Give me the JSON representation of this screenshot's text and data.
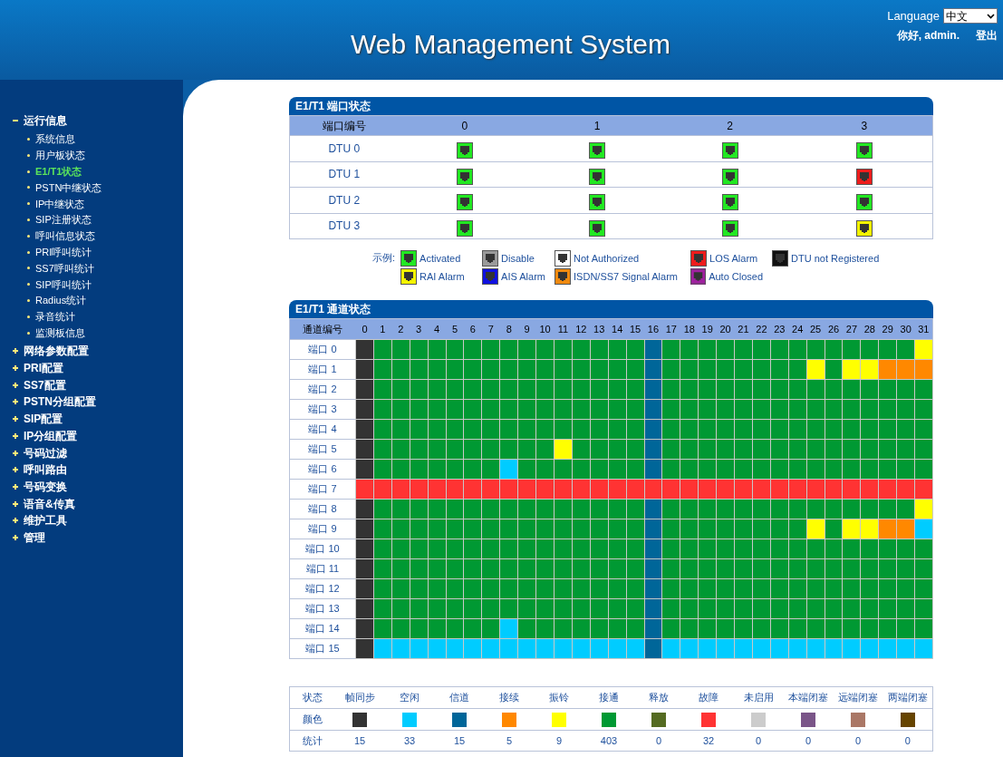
{
  "header": {
    "title": "Web Management System",
    "language_label": "Language",
    "language": "中文",
    "greeting": "你好, admin.",
    "logout": "登出"
  },
  "sidebar": {
    "items": [
      {
        "label": "运行信息",
        "expanded": true,
        "children": [
          {
            "label": "系统信息",
            "selected": false
          },
          {
            "label": "用户板状态",
            "selected": false
          },
          {
            "label": "E1/T1状态",
            "selected": true
          },
          {
            "label": "PSTN中继状态",
            "selected": false
          },
          {
            "label": "IP中继状态",
            "selected": false
          },
          {
            "label": "SIP注册状态",
            "selected": false
          },
          {
            "label": "呼叫信息状态",
            "selected": false
          },
          {
            "label": "PRI呼叫统计",
            "selected": false
          },
          {
            "label": "SS7呼叫统计",
            "selected": false
          },
          {
            "label": "SIP呼叫统计",
            "selected": false
          },
          {
            "label": "Radius统计",
            "selected": false
          },
          {
            "label": "录音统计",
            "selected": false
          },
          {
            "label": "监测板信息",
            "selected": false
          }
        ]
      },
      {
        "label": "网络参数配置",
        "expanded": false
      },
      {
        "label": "PRI配置",
        "expanded": false
      },
      {
        "label": "SS7配置",
        "expanded": false
      },
      {
        "label": "PSTN分组配置",
        "expanded": false
      },
      {
        "label": "SIP配置",
        "expanded": false
      },
      {
        "label": "IP分组配置",
        "expanded": false
      },
      {
        "label": "号码过滤",
        "expanded": false
      },
      {
        "label": "呼叫路由",
        "expanded": false
      },
      {
        "label": "号码变换",
        "expanded": false
      },
      {
        "label": "语音&传真",
        "expanded": false
      },
      {
        "label": "维护工具",
        "expanded": false
      },
      {
        "label": "管理",
        "expanded": false
      }
    ]
  },
  "port_status": {
    "title": "E1/T1 端口状态",
    "corner": "端口编号",
    "columns": [
      "0",
      "1",
      "2",
      "3"
    ],
    "rows": [
      {
        "label": "DTU 0",
        "ports": [
          {
            "kind": "activated"
          },
          {
            "kind": "activated"
          },
          {
            "kind": "activated"
          },
          {
            "kind": "activated"
          }
        ]
      },
      {
        "label": "DTU 1",
        "ports": [
          {
            "kind": "activated"
          },
          {
            "kind": "activated"
          },
          {
            "kind": "activated"
          },
          {
            "kind": "los"
          }
        ]
      },
      {
        "label": "DTU 2",
        "ports": [
          {
            "kind": "activated"
          },
          {
            "kind": "activated"
          },
          {
            "kind": "activated"
          },
          {
            "kind": "activated"
          }
        ]
      },
      {
        "label": "DTU 3",
        "ports": [
          {
            "kind": "activated"
          },
          {
            "kind": "activated"
          },
          {
            "kind": "activated"
          },
          {
            "kind": "rai"
          }
        ]
      }
    ]
  },
  "port_legend": {
    "label": "示例:",
    "items": [
      {
        "label": "Activated",
        "kind": "activated",
        "color": "#22e822"
      },
      {
        "label": "Disable",
        "kind": "disable",
        "color": "#9a9a9a"
      },
      {
        "label": "Not Authorized",
        "kind": "unauthorized",
        "color": "#ffffff"
      },
      {
        "label": "LOS Alarm",
        "kind": "los",
        "color": "#ee1c1c"
      },
      {
        "label": "DTU not Registered",
        "kind": "unregistered",
        "color": "#111111"
      },
      {
        "label": "RAI Alarm",
        "kind": "rai",
        "color": "#f4f400"
      },
      {
        "label": "AIS Alarm",
        "kind": "ais",
        "color": "#1010e0"
      },
      {
        "label": "ISDN/SS7 Signal Alarm",
        "kind": "signal",
        "color": "#f08a10"
      },
      {
        "label": "Auto Closed",
        "kind": "closed",
        "color": "#a020a0"
      }
    ]
  },
  "channel_status": {
    "title": "E1/T1 通道状态",
    "corner": "通道编号",
    "columns": [
      "0",
      "1",
      "2",
      "3",
      "4",
      "5",
      "6",
      "7",
      "8",
      "9",
      "10",
      "11",
      "12",
      "13",
      "14",
      "15",
      "16",
      "17",
      "18",
      "19",
      "20",
      "21",
      "22",
      "23",
      "24",
      "25",
      "26",
      "27",
      "28",
      "29",
      "30",
      "31"
    ],
    "rows": [
      {
        "label": "端口 0",
        "channels": [
          {
            "kind": "sync"
          },
          {
            "kind": "conn"
          },
          {
            "kind": "conn"
          },
          {
            "kind": "conn"
          },
          {
            "kind": "conn"
          },
          {
            "kind": "conn"
          },
          {
            "kind": "conn"
          },
          {
            "kind": "conn"
          },
          {
            "kind": "conn"
          },
          {
            "kind": "conn"
          },
          {
            "kind": "conn"
          },
          {
            "kind": "conn"
          },
          {
            "kind": "conn"
          },
          {
            "kind": "conn"
          },
          {
            "kind": "conn"
          },
          {
            "kind": "conn"
          },
          {
            "kind": "chan"
          },
          {
            "kind": "conn"
          },
          {
            "kind": "conn"
          },
          {
            "kind": "conn"
          },
          {
            "kind": "conn"
          },
          {
            "kind": "conn"
          },
          {
            "kind": "conn"
          },
          {
            "kind": "conn"
          },
          {
            "kind": "conn"
          },
          {
            "kind": "conn"
          },
          {
            "kind": "conn"
          },
          {
            "kind": "conn"
          },
          {
            "kind": "conn"
          },
          {
            "kind": "conn"
          },
          {
            "kind": "conn"
          },
          {
            "kind": "ring"
          }
        ]
      },
      {
        "label": "端口 1",
        "channels": [
          {
            "kind": "sync"
          },
          {
            "kind": "conn"
          },
          {
            "kind": "conn"
          },
          {
            "kind": "conn"
          },
          {
            "kind": "conn"
          },
          {
            "kind": "conn"
          },
          {
            "kind": "conn"
          },
          {
            "kind": "conn"
          },
          {
            "kind": "conn"
          },
          {
            "kind": "conn"
          },
          {
            "kind": "conn"
          },
          {
            "kind": "conn"
          },
          {
            "kind": "conn"
          },
          {
            "kind": "conn"
          },
          {
            "kind": "conn"
          },
          {
            "kind": "conn"
          },
          {
            "kind": "chan"
          },
          {
            "kind": "conn"
          },
          {
            "kind": "conn"
          },
          {
            "kind": "conn"
          },
          {
            "kind": "conn"
          },
          {
            "kind": "conn"
          },
          {
            "kind": "conn"
          },
          {
            "kind": "conn"
          },
          {
            "kind": "conn"
          },
          {
            "kind": "ring"
          },
          {
            "kind": "conn"
          },
          {
            "kind": "ring"
          },
          {
            "kind": "ring"
          },
          {
            "kind": "cont"
          },
          {
            "kind": "cont"
          },
          {
            "kind": "cont"
          }
        ]
      },
      {
        "label": "端口 2",
        "channels": [
          {
            "kind": "sync"
          },
          {
            "kind": "conn"
          },
          {
            "kind": "conn"
          },
          {
            "kind": "conn"
          },
          {
            "kind": "conn"
          },
          {
            "kind": "conn"
          },
          {
            "kind": "conn"
          },
          {
            "kind": "conn"
          },
          {
            "kind": "conn"
          },
          {
            "kind": "conn"
          },
          {
            "kind": "conn"
          },
          {
            "kind": "conn"
          },
          {
            "kind": "conn"
          },
          {
            "kind": "conn"
          },
          {
            "kind": "conn"
          },
          {
            "kind": "conn"
          },
          {
            "kind": "chan"
          },
          {
            "kind": "conn"
          },
          {
            "kind": "conn"
          },
          {
            "kind": "conn"
          },
          {
            "kind": "conn"
          },
          {
            "kind": "conn"
          },
          {
            "kind": "conn"
          },
          {
            "kind": "conn"
          },
          {
            "kind": "conn"
          },
          {
            "kind": "conn"
          },
          {
            "kind": "conn"
          },
          {
            "kind": "conn"
          },
          {
            "kind": "conn"
          },
          {
            "kind": "conn"
          },
          {
            "kind": "conn"
          },
          {
            "kind": "conn"
          }
        ]
      },
      {
        "label": "端口 3",
        "channels": [
          {
            "kind": "sync"
          },
          {
            "kind": "conn"
          },
          {
            "kind": "conn"
          },
          {
            "kind": "conn"
          },
          {
            "kind": "conn"
          },
          {
            "kind": "conn"
          },
          {
            "kind": "conn"
          },
          {
            "kind": "conn"
          },
          {
            "kind": "conn"
          },
          {
            "kind": "conn"
          },
          {
            "kind": "conn"
          },
          {
            "kind": "conn"
          },
          {
            "kind": "conn"
          },
          {
            "kind": "conn"
          },
          {
            "kind": "conn"
          },
          {
            "kind": "conn"
          },
          {
            "kind": "chan"
          },
          {
            "kind": "conn"
          },
          {
            "kind": "conn"
          },
          {
            "kind": "conn"
          },
          {
            "kind": "conn"
          },
          {
            "kind": "conn"
          },
          {
            "kind": "conn"
          },
          {
            "kind": "conn"
          },
          {
            "kind": "conn"
          },
          {
            "kind": "conn"
          },
          {
            "kind": "conn"
          },
          {
            "kind": "conn"
          },
          {
            "kind": "conn"
          },
          {
            "kind": "conn"
          },
          {
            "kind": "conn"
          },
          {
            "kind": "conn"
          }
        ]
      },
      {
        "label": "端口 4",
        "channels": [
          {
            "kind": "sync"
          },
          {
            "kind": "conn"
          },
          {
            "kind": "conn"
          },
          {
            "kind": "conn"
          },
          {
            "kind": "conn"
          },
          {
            "kind": "conn"
          },
          {
            "kind": "conn"
          },
          {
            "kind": "conn"
          },
          {
            "kind": "conn"
          },
          {
            "kind": "conn"
          },
          {
            "kind": "conn"
          },
          {
            "kind": "conn"
          },
          {
            "kind": "conn"
          },
          {
            "kind": "conn"
          },
          {
            "kind": "conn"
          },
          {
            "kind": "conn"
          },
          {
            "kind": "chan"
          },
          {
            "kind": "conn"
          },
          {
            "kind": "conn"
          },
          {
            "kind": "conn"
          },
          {
            "kind": "conn"
          },
          {
            "kind": "conn"
          },
          {
            "kind": "conn"
          },
          {
            "kind": "conn"
          },
          {
            "kind": "conn"
          },
          {
            "kind": "conn"
          },
          {
            "kind": "conn"
          },
          {
            "kind": "conn"
          },
          {
            "kind": "conn"
          },
          {
            "kind": "conn"
          },
          {
            "kind": "conn"
          },
          {
            "kind": "conn"
          }
        ]
      },
      {
        "label": "端口 5",
        "channels": [
          {
            "kind": "sync"
          },
          {
            "kind": "conn"
          },
          {
            "kind": "conn"
          },
          {
            "kind": "conn"
          },
          {
            "kind": "conn"
          },
          {
            "kind": "conn"
          },
          {
            "kind": "conn"
          },
          {
            "kind": "conn"
          },
          {
            "kind": "conn"
          },
          {
            "kind": "conn"
          },
          {
            "kind": "conn"
          },
          {
            "kind": "ring"
          },
          {
            "kind": "conn"
          },
          {
            "kind": "conn"
          },
          {
            "kind": "conn"
          },
          {
            "kind": "conn"
          },
          {
            "kind": "chan"
          },
          {
            "kind": "conn"
          },
          {
            "kind": "conn"
          },
          {
            "kind": "conn"
          },
          {
            "kind": "conn"
          },
          {
            "kind": "conn"
          },
          {
            "kind": "conn"
          },
          {
            "kind": "conn"
          },
          {
            "kind": "conn"
          },
          {
            "kind": "conn"
          },
          {
            "kind": "conn"
          },
          {
            "kind": "conn"
          },
          {
            "kind": "conn"
          },
          {
            "kind": "conn"
          },
          {
            "kind": "conn"
          },
          {
            "kind": "conn"
          }
        ]
      },
      {
        "label": "端口 6",
        "channels": [
          {
            "kind": "sync"
          },
          {
            "kind": "conn"
          },
          {
            "kind": "conn"
          },
          {
            "kind": "conn"
          },
          {
            "kind": "conn"
          },
          {
            "kind": "conn"
          },
          {
            "kind": "conn"
          },
          {
            "kind": "conn"
          },
          {
            "kind": "idle"
          },
          {
            "kind": "conn"
          },
          {
            "kind": "conn"
          },
          {
            "kind": "conn"
          },
          {
            "kind": "conn"
          },
          {
            "kind": "conn"
          },
          {
            "kind": "conn"
          },
          {
            "kind": "conn"
          },
          {
            "kind": "chan"
          },
          {
            "kind": "conn"
          },
          {
            "kind": "conn"
          },
          {
            "kind": "conn"
          },
          {
            "kind": "conn"
          },
          {
            "kind": "conn"
          },
          {
            "kind": "conn"
          },
          {
            "kind": "conn"
          },
          {
            "kind": "conn"
          },
          {
            "kind": "conn"
          },
          {
            "kind": "conn"
          },
          {
            "kind": "conn"
          },
          {
            "kind": "conn"
          },
          {
            "kind": "conn"
          },
          {
            "kind": "conn"
          },
          {
            "kind": "conn"
          }
        ]
      },
      {
        "label": "端口 7",
        "channels": [
          {
            "kind": "fault"
          },
          {
            "kind": "fault"
          },
          {
            "kind": "fault"
          },
          {
            "kind": "fault"
          },
          {
            "kind": "fault"
          },
          {
            "kind": "fault"
          },
          {
            "kind": "fault"
          },
          {
            "kind": "fault"
          },
          {
            "kind": "fault"
          },
          {
            "kind": "fault"
          },
          {
            "kind": "fault"
          },
          {
            "kind": "fault"
          },
          {
            "kind": "fault"
          },
          {
            "kind": "fault"
          },
          {
            "kind": "fault"
          },
          {
            "kind": "fault"
          },
          {
            "kind": "fault"
          },
          {
            "kind": "fault"
          },
          {
            "kind": "fault"
          },
          {
            "kind": "fault"
          },
          {
            "kind": "fault"
          },
          {
            "kind": "fault"
          },
          {
            "kind": "fault"
          },
          {
            "kind": "fault"
          },
          {
            "kind": "fault"
          },
          {
            "kind": "fault"
          },
          {
            "kind": "fault"
          },
          {
            "kind": "fault"
          },
          {
            "kind": "fault"
          },
          {
            "kind": "fault"
          },
          {
            "kind": "fault"
          },
          {
            "kind": "fault"
          }
        ]
      },
      {
        "label": "端口 8",
        "channels": [
          {
            "kind": "sync"
          },
          {
            "kind": "conn"
          },
          {
            "kind": "conn"
          },
          {
            "kind": "conn"
          },
          {
            "kind": "conn"
          },
          {
            "kind": "conn"
          },
          {
            "kind": "conn"
          },
          {
            "kind": "conn"
          },
          {
            "kind": "conn"
          },
          {
            "kind": "conn"
          },
          {
            "kind": "conn"
          },
          {
            "kind": "conn"
          },
          {
            "kind": "conn"
          },
          {
            "kind": "conn"
          },
          {
            "kind": "conn"
          },
          {
            "kind": "conn"
          },
          {
            "kind": "chan"
          },
          {
            "kind": "conn"
          },
          {
            "kind": "conn"
          },
          {
            "kind": "conn"
          },
          {
            "kind": "conn"
          },
          {
            "kind": "conn"
          },
          {
            "kind": "conn"
          },
          {
            "kind": "conn"
          },
          {
            "kind": "conn"
          },
          {
            "kind": "conn"
          },
          {
            "kind": "conn"
          },
          {
            "kind": "conn"
          },
          {
            "kind": "conn"
          },
          {
            "kind": "conn"
          },
          {
            "kind": "conn"
          },
          {
            "kind": "ring"
          }
        ]
      },
      {
        "label": "端口 9",
        "channels": [
          {
            "kind": "sync"
          },
          {
            "kind": "conn"
          },
          {
            "kind": "conn"
          },
          {
            "kind": "conn"
          },
          {
            "kind": "conn"
          },
          {
            "kind": "conn"
          },
          {
            "kind": "conn"
          },
          {
            "kind": "conn"
          },
          {
            "kind": "conn"
          },
          {
            "kind": "conn"
          },
          {
            "kind": "conn"
          },
          {
            "kind": "conn"
          },
          {
            "kind": "conn"
          },
          {
            "kind": "conn"
          },
          {
            "kind": "conn"
          },
          {
            "kind": "conn"
          },
          {
            "kind": "chan"
          },
          {
            "kind": "conn"
          },
          {
            "kind": "conn"
          },
          {
            "kind": "conn"
          },
          {
            "kind": "conn"
          },
          {
            "kind": "conn"
          },
          {
            "kind": "conn"
          },
          {
            "kind": "conn"
          },
          {
            "kind": "conn"
          },
          {
            "kind": "ring"
          },
          {
            "kind": "conn"
          },
          {
            "kind": "ring"
          },
          {
            "kind": "ring"
          },
          {
            "kind": "cont"
          },
          {
            "kind": "cont"
          },
          {
            "kind": "idle"
          }
        ]
      },
      {
        "label": "端口 10",
        "channels": [
          {
            "kind": "sync"
          },
          {
            "kind": "conn"
          },
          {
            "kind": "conn"
          },
          {
            "kind": "conn"
          },
          {
            "kind": "conn"
          },
          {
            "kind": "conn"
          },
          {
            "kind": "conn"
          },
          {
            "kind": "conn"
          },
          {
            "kind": "conn"
          },
          {
            "kind": "conn"
          },
          {
            "kind": "conn"
          },
          {
            "kind": "conn"
          },
          {
            "kind": "conn"
          },
          {
            "kind": "conn"
          },
          {
            "kind": "conn"
          },
          {
            "kind": "conn"
          },
          {
            "kind": "chan"
          },
          {
            "kind": "conn"
          },
          {
            "kind": "conn"
          },
          {
            "kind": "conn"
          },
          {
            "kind": "conn"
          },
          {
            "kind": "conn"
          },
          {
            "kind": "conn"
          },
          {
            "kind": "conn"
          },
          {
            "kind": "conn"
          },
          {
            "kind": "conn"
          },
          {
            "kind": "conn"
          },
          {
            "kind": "conn"
          },
          {
            "kind": "conn"
          },
          {
            "kind": "conn"
          },
          {
            "kind": "conn"
          },
          {
            "kind": "conn"
          }
        ]
      },
      {
        "label": "端口 11",
        "channels": [
          {
            "kind": "sync"
          },
          {
            "kind": "conn"
          },
          {
            "kind": "conn"
          },
          {
            "kind": "conn"
          },
          {
            "kind": "conn"
          },
          {
            "kind": "conn"
          },
          {
            "kind": "conn"
          },
          {
            "kind": "conn"
          },
          {
            "kind": "conn"
          },
          {
            "kind": "conn"
          },
          {
            "kind": "conn"
          },
          {
            "kind": "conn"
          },
          {
            "kind": "conn"
          },
          {
            "kind": "conn"
          },
          {
            "kind": "conn"
          },
          {
            "kind": "conn"
          },
          {
            "kind": "chan"
          },
          {
            "kind": "conn"
          },
          {
            "kind": "conn"
          },
          {
            "kind": "conn"
          },
          {
            "kind": "conn"
          },
          {
            "kind": "conn"
          },
          {
            "kind": "conn"
          },
          {
            "kind": "conn"
          },
          {
            "kind": "conn"
          },
          {
            "kind": "conn"
          },
          {
            "kind": "conn"
          },
          {
            "kind": "conn"
          },
          {
            "kind": "conn"
          },
          {
            "kind": "conn"
          },
          {
            "kind": "conn"
          },
          {
            "kind": "conn"
          }
        ]
      },
      {
        "label": "端口 12",
        "channels": [
          {
            "kind": "sync"
          },
          {
            "kind": "conn"
          },
          {
            "kind": "conn"
          },
          {
            "kind": "conn"
          },
          {
            "kind": "conn"
          },
          {
            "kind": "conn"
          },
          {
            "kind": "conn"
          },
          {
            "kind": "conn"
          },
          {
            "kind": "conn"
          },
          {
            "kind": "conn"
          },
          {
            "kind": "conn"
          },
          {
            "kind": "conn"
          },
          {
            "kind": "conn"
          },
          {
            "kind": "conn"
          },
          {
            "kind": "conn"
          },
          {
            "kind": "conn"
          },
          {
            "kind": "chan"
          },
          {
            "kind": "conn"
          },
          {
            "kind": "conn"
          },
          {
            "kind": "conn"
          },
          {
            "kind": "conn"
          },
          {
            "kind": "conn"
          },
          {
            "kind": "conn"
          },
          {
            "kind": "conn"
          },
          {
            "kind": "conn"
          },
          {
            "kind": "conn"
          },
          {
            "kind": "conn"
          },
          {
            "kind": "conn"
          },
          {
            "kind": "conn"
          },
          {
            "kind": "conn"
          },
          {
            "kind": "conn"
          },
          {
            "kind": "conn"
          }
        ]
      },
      {
        "label": "端口 13",
        "channels": [
          {
            "kind": "sync"
          },
          {
            "kind": "conn"
          },
          {
            "kind": "conn"
          },
          {
            "kind": "conn"
          },
          {
            "kind": "conn"
          },
          {
            "kind": "conn"
          },
          {
            "kind": "conn"
          },
          {
            "kind": "conn"
          },
          {
            "kind": "conn"
          },
          {
            "kind": "conn"
          },
          {
            "kind": "conn"
          },
          {
            "kind": "conn"
          },
          {
            "kind": "conn"
          },
          {
            "kind": "conn"
          },
          {
            "kind": "conn"
          },
          {
            "kind": "conn"
          },
          {
            "kind": "chan"
          },
          {
            "kind": "conn"
          },
          {
            "kind": "conn"
          },
          {
            "kind": "conn"
          },
          {
            "kind": "conn"
          },
          {
            "kind": "conn"
          },
          {
            "kind": "conn"
          },
          {
            "kind": "conn"
          },
          {
            "kind": "conn"
          },
          {
            "kind": "conn"
          },
          {
            "kind": "conn"
          },
          {
            "kind": "conn"
          },
          {
            "kind": "conn"
          },
          {
            "kind": "conn"
          },
          {
            "kind": "conn"
          },
          {
            "kind": "conn"
          }
        ]
      },
      {
        "label": "端口 14",
        "channels": [
          {
            "kind": "sync"
          },
          {
            "kind": "conn"
          },
          {
            "kind": "conn"
          },
          {
            "kind": "conn"
          },
          {
            "kind": "conn"
          },
          {
            "kind": "conn"
          },
          {
            "kind": "conn"
          },
          {
            "kind": "conn"
          },
          {
            "kind": "idle"
          },
          {
            "kind": "conn"
          },
          {
            "kind": "conn"
          },
          {
            "kind": "conn"
          },
          {
            "kind": "conn"
          },
          {
            "kind": "conn"
          },
          {
            "kind": "conn"
          },
          {
            "kind": "conn"
          },
          {
            "kind": "chan"
          },
          {
            "kind": "conn"
          },
          {
            "kind": "conn"
          },
          {
            "kind": "conn"
          },
          {
            "kind": "conn"
          },
          {
            "kind": "conn"
          },
          {
            "kind": "conn"
          },
          {
            "kind": "conn"
          },
          {
            "kind": "conn"
          },
          {
            "kind": "conn"
          },
          {
            "kind": "conn"
          },
          {
            "kind": "conn"
          },
          {
            "kind": "conn"
          },
          {
            "kind": "conn"
          },
          {
            "kind": "conn"
          },
          {
            "kind": "conn"
          }
        ]
      },
      {
        "label": "端口 15",
        "channels": [
          {
            "kind": "sync"
          },
          {
            "kind": "idle"
          },
          {
            "kind": "idle"
          },
          {
            "kind": "idle"
          },
          {
            "kind": "idle"
          },
          {
            "kind": "idle"
          },
          {
            "kind": "idle"
          },
          {
            "kind": "idle"
          },
          {
            "kind": "idle"
          },
          {
            "kind": "idle"
          },
          {
            "kind": "idle"
          },
          {
            "kind": "idle"
          },
          {
            "kind": "idle"
          },
          {
            "kind": "idle"
          },
          {
            "kind": "idle"
          },
          {
            "kind": "idle"
          },
          {
            "kind": "chan"
          },
          {
            "kind": "idle"
          },
          {
            "kind": "idle"
          },
          {
            "kind": "idle"
          },
          {
            "kind": "idle"
          },
          {
            "kind": "idle"
          },
          {
            "kind": "idle"
          },
          {
            "kind": "idle"
          },
          {
            "kind": "idle"
          },
          {
            "kind": "idle"
          },
          {
            "kind": "idle"
          },
          {
            "kind": "idle"
          },
          {
            "kind": "idle"
          },
          {
            "kind": "idle"
          },
          {
            "kind": "idle"
          },
          {
            "kind": "idle"
          }
        ]
      }
    ]
  },
  "summary": {
    "row_labels": [
      "状态",
      "颜色",
      "统计"
    ],
    "items": [
      {
        "label": "帧同步",
        "kind": "sync",
        "color": "#333333",
        "count": "15"
      },
      {
        "label": "空闲",
        "kind": "idle",
        "color": "#00ccff",
        "count": "33"
      },
      {
        "label": "信道",
        "kind": "chan",
        "color": "#006699",
        "count": "15"
      },
      {
        "label": "接续",
        "kind": "cont",
        "color": "#ff8800",
        "count": "5"
      },
      {
        "label": "振铃",
        "kind": "ring",
        "color": "#ffff00",
        "count": "9"
      },
      {
        "label": "接通",
        "kind": "conn",
        "color": "#009933",
        "count": "403"
      },
      {
        "label": "释放",
        "kind": "rel",
        "color": "#556b22",
        "count": "0"
      },
      {
        "label": "故障",
        "kind": "fault",
        "color": "#ff3333",
        "count": "32"
      },
      {
        "label": "未启用",
        "kind": "off",
        "color": "#cccccc",
        "count": "0"
      },
      {
        "label": "本端闭塞",
        "kind": "lblk",
        "color": "#7a5588",
        "count": "0"
      },
      {
        "label": "远端闭塞",
        "kind": "rblk",
        "color": "#aa7766",
        "count": "0"
      },
      {
        "label": "两端闭塞",
        "kind": "bblk",
        "color": "#664400",
        "count": "0"
      }
    ]
  }
}
